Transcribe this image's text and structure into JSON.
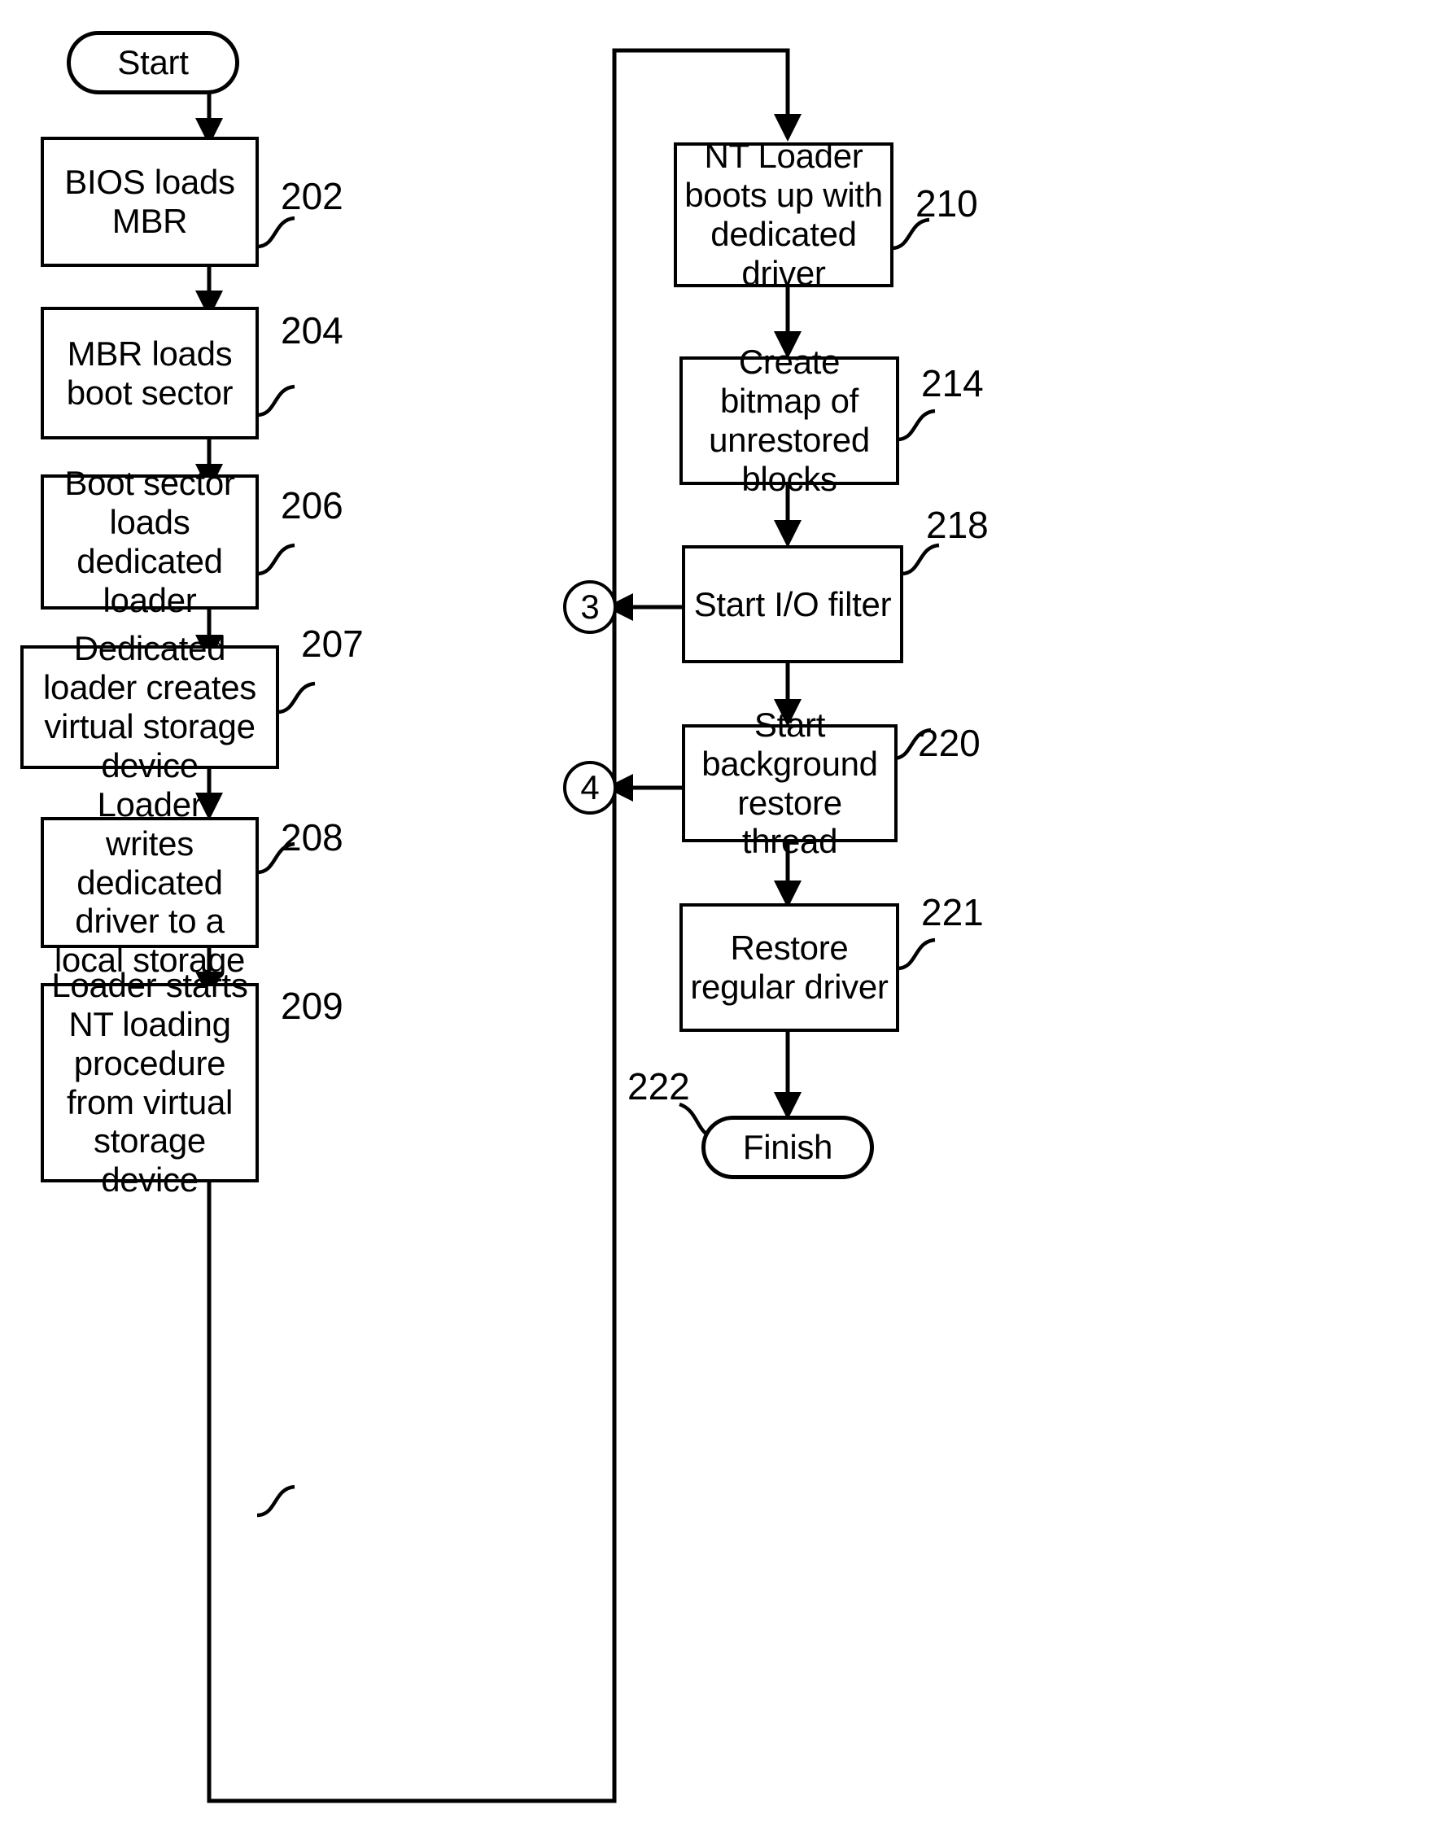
{
  "figure": {
    "type": "flowchart",
    "orientation": "two-column",
    "background_color": "#ffffff",
    "line_color": "#000000"
  },
  "nodes": {
    "start": {
      "label": "Start",
      "shape": "terminator"
    },
    "n202": {
      "label": "BIOS loads MBR",
      "shape": "process",
      "ref": "202"
    },
    "n204": {
      "label": "MBR loads boot sector",
      "shape": "process",
      "ref": "204"
    },
    "n206": {
      "label": "Boot sector loads dedicated loader",
      "shape": "process",
      "ref": "206"
    },
    "n207": {
      "label": "Dedicated loader creates virtual storage device",
      "shape": "process",
      "ref": "207"
    },
    "n208": {
      "label": "Loader writes dedicated driver to a local storage",
      "shape": "process",
      "ref": "208"
    },
    "n209": {
      "label": "Loader starts NT loading procedure from virtual storage device",
      "shape": "process",
      "ref": "209"
    },
    "n210": {
      "label": "NT Loader boots up with dedicated driver",
      "shape": "process",
      "ref": "210"
    },
    "n214": {
      "label": "Create bitmap of unrestored blocks",
      "shape": "process",
      "ref": "214"
    },
    "n218": {
      "label": "Start I/O filter",
      "shape": "process",
      "ref": "218"
    },
    "n220": {
      "label": "Start background restore thread",
      "shape": "process",
      "ref": "220"
    },
    "n221": {
      "label": "Restore regular driver",
      "shape": "process",
      "ref": "221"
    },
    "finish": {
      "label": "Finish",
      "shape": "terminator",
      "ref": "222"
    }
  },
  "offpage_connectors": {
    "c3": {
      "label": "3",
      "from": "n218"
    },
    "c4": {
      "label": "4",
      "from": "n220"
    }
  },
  "reference_numerals": {
    "r202": "202",
    "r204": "204",
    "r206": "206",
    "r207": "207",
    "r208": "208",
    "r209": "209",
    "r210": "210",
    "r214": "214",
    "r218": "218",
    "r220": "220",
    "r221": "221",
    "r222": "222"
  }
}
